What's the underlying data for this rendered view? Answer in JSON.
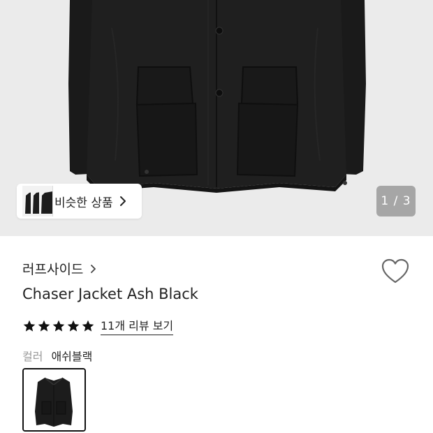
{
  "gallery": {
    "similar_label": "비슷한 상품",
    "pager": "1 / 3"
  },
  "product": {
    "brand": "러프사이드",
    "title": "Chaser Jacket Ash Black",
    "rating": 5,
    "rating_max": 5,
    "review_link": "11개 리뷰 보기",
    "color_label": "컬러",
    "color_value": "애쉬블랙"
  },
  "colors": {
    "hero_bg": "#ebebeb",
    "jacket": "#1c1c1c",
    "text": "#222222",
    "muted": "#999999"
  },
  "icons": {
    "heart": "heart-outline-icon",
    "chevron": "chevron-right-icon",
    "star": "star-filled-icon"
  }
}
